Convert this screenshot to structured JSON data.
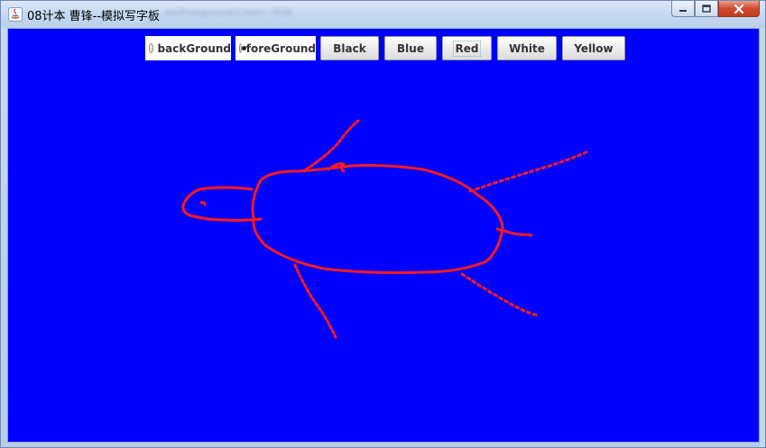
{
  "window": {
    "title": "08计本 曹锋--模拟写字板",
    "title_suffix_blurred": "(...ain/Foreground:Colors - RGB",
    "controls": {
      "minimize": "minimize",
      "maximize": "maximize",
      "close": "close"
    }
  },
  "toolbar": {
    "radios": [
      {
        "label": "backGround",
        "checked": false
      },
      {
        "label": "foreGround",
        "checked": true
      }
    ],
    "buttons": [
      {
        "label": "Black"
      },
      {
        "label": "Blue"
      },
      {
        "label": "Red",
        "focused": true
      },
      {
        "label": "White"
      },
      {
        "label": "Yellow"
      }
    ]
  },
  "canvas": {
    "background_color": "#0000ff",
    "stroke_color": "#ff0000",
    "drawing": "turtle-sketch"
  }
}
